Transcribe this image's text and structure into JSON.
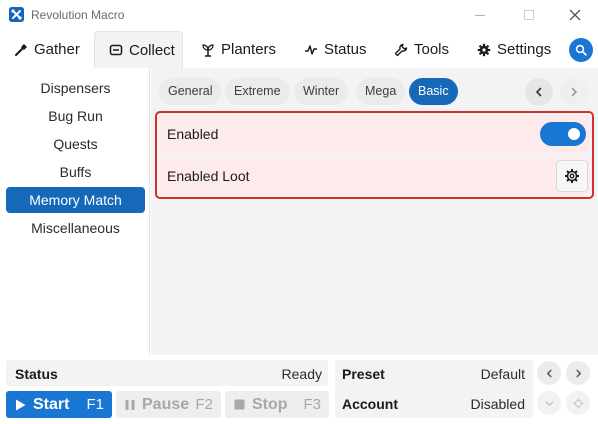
{
  "window": {
    "title": "Revolution Macro",
    "app_icon_glyph": "⌘"
  },
  "tabs": [
    {
      "label": "Gather",
      "icon": "shovel-icon"
    },
    {
      "label": "Collect",
      "icon": "collect-icon",
      "active": true
    },
    {
      "label": "Planters",
      "icon": "plant-icon"
    },
    {
      "label": "Status",
      "icon": "pulse-icon"
    },
    {
      "label": "Tools",
      "icon": "wrench-icon"
    },
    {
      "label": "Settings",
      "icon": "gear-icon"
    }
  ],
  "sidebar": {
    "items": [
      {
        "label": "Dispensers"
      },
      {
        "label": "Bug Run"
      },
      {
        "label": "Quests"
      },
      {
        "label": "Buffs"
      },
      {
        "label": "Memory Match",
        "active": true
      },
      {
        "label": "Miscellaneous"
      }
    ]
  },
  "subtabs": [
    {
      "label": "General"
    },
    {
      "label": "Extreme"
    },
    {
      "label": "Winter"
    },
    {
      "label": "Mega"
    },
    {
      "label": "Basic",
      "active": true
    }
  ],
  "options": {
    "enabled_label": "Enabled",
    "enabled_on": true,
    "enabled_loot_label": "Enabled Loot"
  },
  "status": {
    "label": "Status",
    "value": "Ready"
  },
  "controls": {
    "start_label": "Start",
    "start_key": "F1",
    "pause_label": "Pause",
    "pause_key": "F2",
    "stop_label": "Stop",
    "stop_key": "F3"
  },
  "preset": {
    "label": "Preset",
    "value": "Default"
  },
  "account": {
    "label": "Account",
    "value": "Disabled"
  },
  "colors": {
    "accent": "#1976d2",
    "highlight_border": "#d32f2f",
    "highlight_bg": "#fdeaea"
  }
}
